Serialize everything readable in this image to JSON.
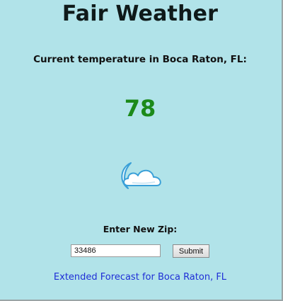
{
  "header": {
    "title": "Fair Weather"
  },
  "current": {
    "label": "Current temperature in Boca Raton, FL:",
    "temperature": "78",
    "condition_icon": "partly-cloudy-night-icon"
  },
  "zip_form": {
    "label": "Enter New Zip:",
    "zip_value": "33486",
    "submit_label": "Submit"
  },
  "forecast_link": {
    "text": "Extended Forecast for Boca Raton, FL"
  },
  "colors": {
    "background": "#b1e3e9",
    "temperature": "#1c8a1a",
    "link": "#1f2fd6"
  }
}
